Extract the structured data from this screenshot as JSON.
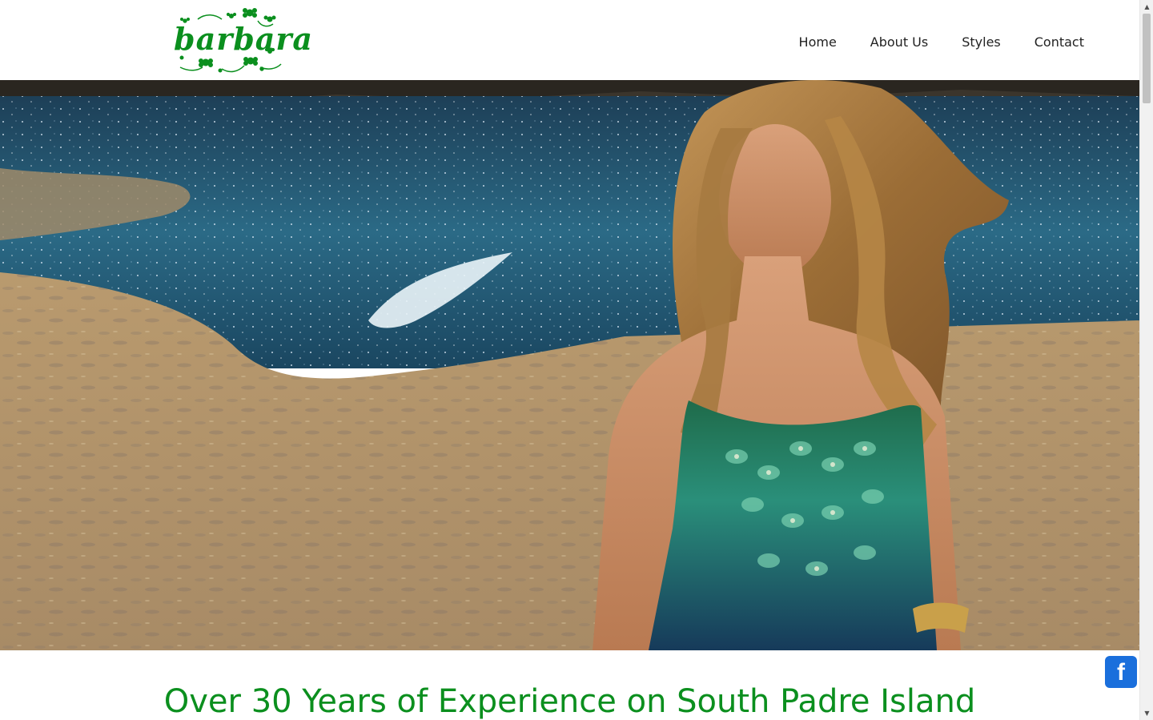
{
  "header": {
    "logo_text": "barbara",
    "nav": [
      {
        "label": "Home"
      },
      {
        "label": "About Us"
      },
      {
        "label": "Styles"
      },
      {
        "label": "Contact"
      }
    ]
  },
  "hero": {
    "image_alt": "hero-photo"
  },
  "main": {
    "headline": "Over 30 Years of Experience on South Padre Island"
  },
  "social": {
    "facebook_glyph": "f",
    "icon": "facebook-icon"
  },
  "colors": {
    "brand_green": "#0b8f1e",
    "facebook_blue": "#1a6fdc"
  },
  "scrollbar": {
    "up_arrow": "▲",
    "down_arrow": "▼"
  }
}
